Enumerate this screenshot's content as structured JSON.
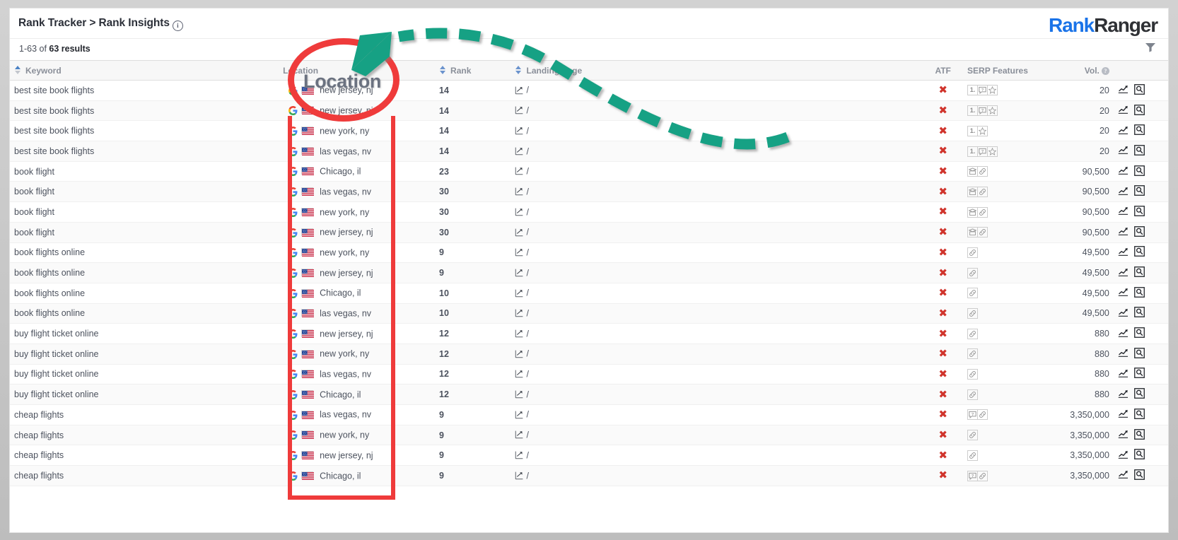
{
  "app": {
    "breadcrumb": "Rank Tracker > Rank Insights",
    "info_icon": "i",
    "logo_first": "Rank",
    "logo_second": "Ranger",
    "filter_icon": "filter-icon"
  },
  "results": {
    "prefix": "1-63 of ",
    "count_label": "63 results"
  },
  "columns": {
    "keyword": "Keyword",
    "location": "Location",
    "rank": "Rank",
    "landing_page": "Landing Page",
    "atf": "ATF",
    "serp_features": "SERP Features",
    "vol": "Vol.",
    "vol_help": "?"
  },
  "annotations": {
    "location_callout": "Location",
    "circle_color": "#ef3b3b",
    "arrow_color": "#13a184",
    "box_color": "#ef3b3b"
  },
  "icons": {
    "google": "google-g-icon",
    "flag": "us-flag-icon",
    "landing_page": "external-link-icon",
    "atf_false": "red-x-icon",
    "trend": "trend-chart-icon",
    "serp_preview": "serp-preview-icon",
    "chip_numbered": "numbered-list-icon",
    "chip_qa": "question-bubble-icon",
    "chip_star": "star-reviews-icon",
    "chip_shopping": "shopping-carousel-icon",
    "chip_link": "sitelinks-icon"
  },
  "rows": [
    {
      "keyword": "best site book flights",
      "location": "new jersey, nj",
      "rank": "14",
      "landing": "/",
      "atf": "✖",
      "serp": [
        "num",
        "qa",
        "star"
      ],
      "vol": "20"
    },
    {
      "keyword": "best site book flights",
      "location": "new jersey, nj",
      "rank": "14",
      "landing": "/",
      "atf": "✖",
      "serp": [
        "num",
        "qa",
        "star"
      ],
      "vol": "20"
    },
    {
      "keyword": "best site book flights",
      "location": "new york, ny",
      "rank": "14",
      "landing": "/",
      "atf": "✖",
      "serp": [
        "num",
        "star"
      ],
      "vol": "20"
    },
    {
      "keyword": "best site book flights",
      "location": "las vegas, nv",
      "rank": "14",
      "landing": "/",
      "atf": "✖",
      "serp": [
        "num",
        "qa",
        "star"
      ],
      "vol": "20"
    },
    {
      "keyword": "book flight",
      "location": "Chicago, il",
      "rank": "23",
      "landing": "/",
      "atf": "✖",
      "serp": [
        "shop",
        "link"
      ],
      "vol": "90,500"
    },
    {
      "keyword": "book flight",
      "location": "las vegas, nv",
      "rank": "30",
      "landing": "/",
      "atf": "✖",
      "serp": [
        "shop",
        "link"
      ],
      "vol": "90,500"
    },
    {
      "keyword": "book flight",
      "location": "new york, ny",
      "rank": "30",
      "landing": "/",
      "atf": "✖",
      "serp": [
        "shop",
        "link"
      ],
      "vol": "90,500"
    },
    {
      "keyword": "book flight",
      "location": "new jersey, nj",
      "rank": "30",
      "landing": "/",
      "atf": "✖",
      "serp": [
        "shop",
        "link"
      ],
      "vol": "90,500"
    },
    {
      "keyword": "book flights online",
      "location": "new york, ny",
      "rank": "9",
      "landing": "/",
      "atf": "✖",
      "serp": [
        "link"
      ],
      "vol": "49,500"
    },
    {
      "keyword": "book flights online",
      "location": "new jersey, nj",
      "rank": "9",
      "landing": "/",
      "atf": "✖",
      "serp": [
        "link"
      ],
      "vol": "49,500"
    },
    {
      "keyword": "book flights online",
      "location": "Chicago, il",
      "rank": "10",
      "landing": "/",
      "atf": "✖",
      "serp": [
        "link"
      ],
      "vol": "49,500"
    },
    {
      "keyword": "book flights online",
      "location": "las vegas, nv",
      "rank": "10",
      "landing": "/",
      "atf": "✖",
      "serp": [
        "link"
      ],
      "vol": "49,500"
    },
    {
      "keyword": "buy flight ticket online",
      "location": "new jersey, nj",
      "rank": "12",
      "landing": "/",
      "atf": "✖",
      "serp": [
        "link"
      ],
      "vol": "880"
    },
    {
      "keyword": "buy flight ticket online",
      "location": "new york, ny",
      "rank": "12",
      "landing": "/",
      "atf": "✖",
      "serp": [
        "link"
      ],
      "vol": "880"
    },
    {
      "keyword": "buy flight ticket online",
      "location": "las vegas, nv",
      "rank": "12",
      "landing": "/",
      "atf": "✖",
      "serp": [
        "link"
      ],
      "vol": "880"
    },
    {
      "keyword": "buy flight ticket online",
      "location": "Chicago, il",
      "rank": "12",
      "landing": "/",
      "atf": "✖",
      "serp": [
        "link"
      ],
      "vol": "880"
    },
    {
      "keyword": "cheap flights",
      "location": "las vegas, nv",
      "rank": "9",
      "landing": "/",
      "atf": "✖",
      "serp": [
        "qa",
        "link"
      ],
      "vol": "3,350,000"
    },
    {
      "keyword": "cheap flights",
      "location": "new york, ny",
      "rank": "9",
      "landing": "/",
      "atf": "✖",
      "serp": [
        "link"
      ],
      "vol": "3,350,000"
    },
    {
      "keyword": "cheap flights",
      "location": "new jersey, nj",
      "rank": "9",
      "landing": "/",
      "atf": "✖",
      "serp": [
        "link"
      ],
      "vol": "3,350,000"
    },
    {
      "keyword": "cheap flights",
      "location": "Chicago, il",
      "rank": "9",
      "landing": "/",
      "atf": "✖",
      "serp": [
        "qa",
        "link"
      ],
      "vol": "3,350,000"
    }
  ]
}
